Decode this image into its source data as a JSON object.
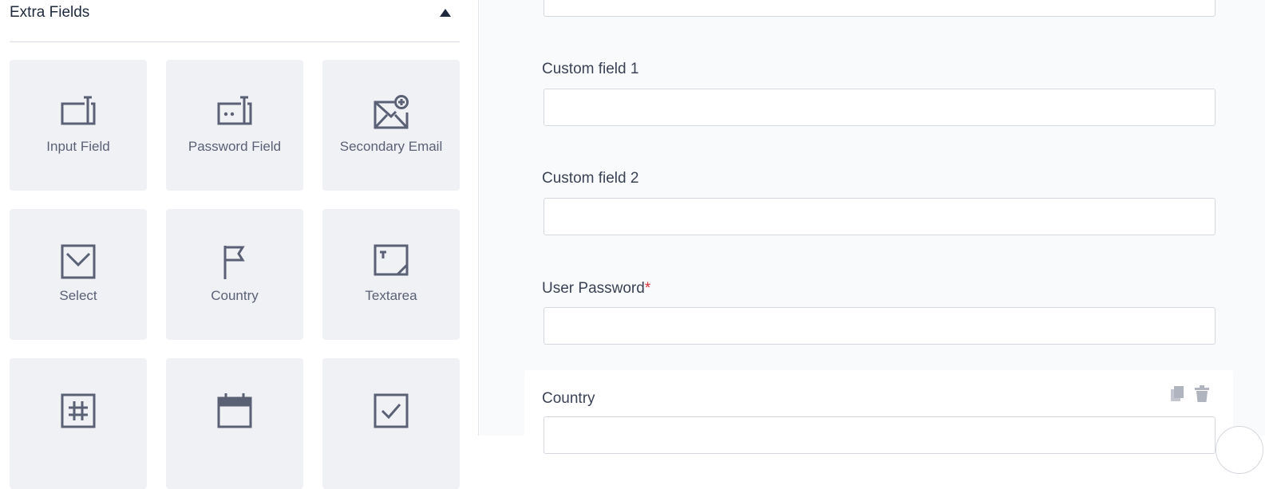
{
  "sidebar": {
    "section_title": "Extra Fields",
    "tiles": [
      {
        "label": "Input Field",
        "icon": "input-field-icon"
      },
      {
        "label": "Password Field",
        "icon": "password-field-icon"
      },
      {
        "label": "Secondary Email",
        "icon": "secondary-email-icon"
      },
      {
        "label": "Select",
        "icon": "select-icon"
      },
      {
        "label": "Country",
        "icon": "country-flag-icon"
      },
      {
        "label": "Textarea",
        "icon": "textarea-icon"
      },
      {
        "label": "",
        "icon": "number-icon"
      },
      {
        "label": "",
        "icon": "date-calendar-icon"
      },
      {
        "label": "",
        "icon": "checkbox-icon"
      }
    ]
  },
  "form": {
    "fields": [
      {
        "label": "Custom field 1",
        "value": ""
      },
      {
        "label": "Custom field 2",
        "value": ""
      },
      {
        "label": "User Password",
        "required_mark": "*",
        "value": ""
      }
    ],
    "country": {
      "label": "Country"
    }
  },
  "colors": {
    "icon": "#5b6175",
    "tile_bg": "#f0f1f5",
    "required": "#d63638",
    "form_bg": "#f9fafc"
  }
}
